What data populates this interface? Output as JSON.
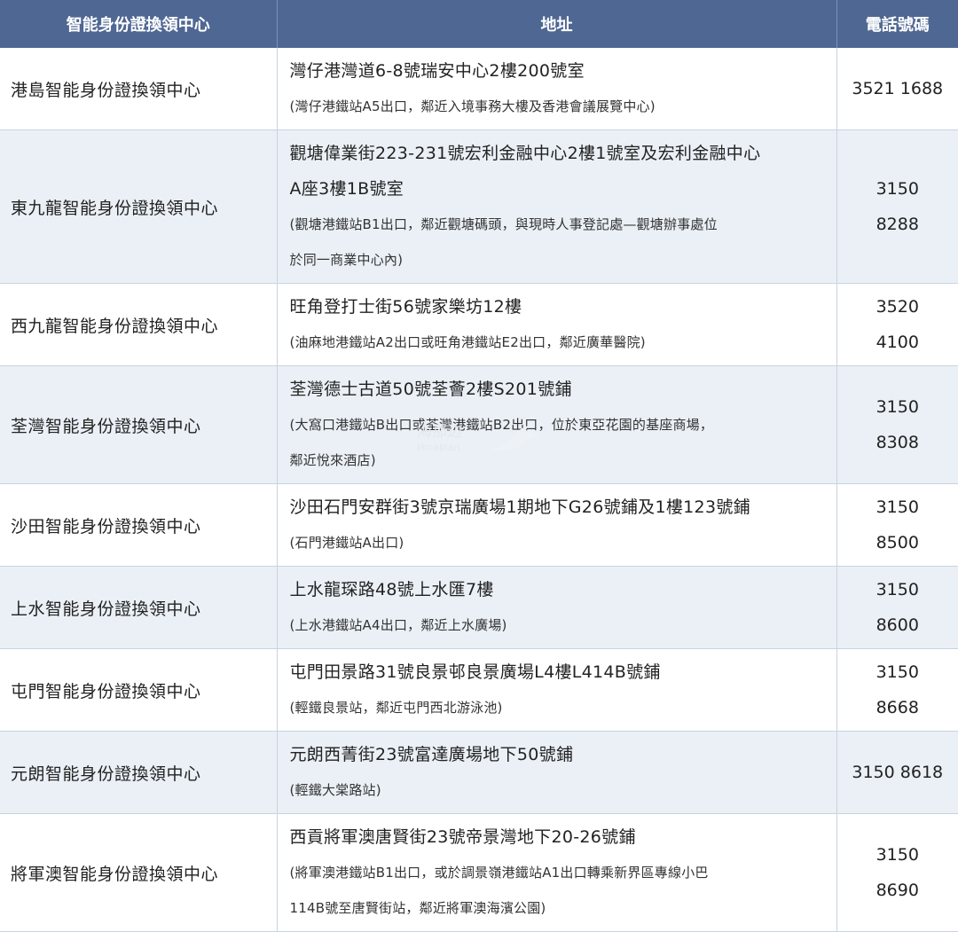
{
  "header": {
    "col_name": "智能身份證換領中心",
    "col_address": "地址",
    "col_phone": "電話號碼"
  },
  "rows": [
    {
      "name": "港島智能身份證換領中心",
      "address_lines": [
        "灣仔港灣道6-8號瑞安中心2樓200號室"
      ],
      "note_lines": [
        "(灣仔港鐵站A5出口，鄰近入境事務大樓及香港會議展覽中心)"
      ],
      "phone_lines": [
        "3521 1688"
      ]
    },
    {
      "name": "東九龍智能身份證換領中心",
      "address_lines": [
        "觀塘偉業街223-231號宏利金融中心2樓1號室及宏利金融中心",
        "A座3樓1B號室"
      ],
      "note_lines": [
        "(觀塘港鐵站B1出口，鄰近觀塘碼頭，與現時人事登記處—觀塘辦事處位",
        "於同一商業中心內)"
      ],
      "phone_lines": [
        "3150",
        "8288"
      ]
    },
    {
      "name": "西九龍智能身份證換領中心",
      "address_lines": [
        "旺角登打士街56號家樂坊12樓"
      ],
      "note_lines": [
        "(油麻地港鐵站A2出口或旺角港鐵站E2出口，鄰近廣華醫院)"
      ],
      "phone_lines": [
        "3520",
        "4100"
      ]
    },
    {
      "name": "荃灣智能身份證換領中心",
      "address_lines": [
        "荃灣德士古道50號荃薈2樓S201號鋪"
      ],
      "note_lines": [
        "(大窩口港鐵站B出口或荃灣港鐵站B2出口，位於東亞花園的基座商場，",
        "鄰近悅來酒店)"
      ],
      "phone_lines": [
        "3150",
        "8308"
      ]
    },
    {
      "name": "沙田智能身份證換領中心",
      "address_lines": [
        "沙田石門安群街3號京瑞廣場1期地下G26號鋪及1樓123號鋪"
      ],
      "note_lines": [
        "(石門港鐵站A出口)"
      ],
      "phone_lines": [
        "3150",
        "8500"
      ]
    },
    {
      "name": "上水智能身份證換領中心",
      "address_lines": [
        "上水龍琛路48號上水匯7樓"
      ],
      "note_lines": [
        "(上水港鐵站A4出口，鄰近上水廣場)"
      ],
      "phone_lines": [
        "3150",
        "8600"
      ]
    },
    {
      "name": "屯門智能身份證換領中心",
      "address_lines": [
        "屯門田景路31號良景邨良景廣場L4樓L414B號鋪"
      ],
      "note_lines": [
        "(輕鐵良景站，鄰近屯門西北游泳池)"
      ],
      "phone_lines": [
        "3150",
        "8668"
      ]
    },
    {
      "name": "元朗智能身份證換領中心",
      "address_lines": [
        "元朗西菁街23號富達廣場地下50號鋪"
      ],
      "note_lines": [
        "(輕鐵大棠路站)"
      ],
      "phone_lines": [
        "3150 8618"
      ]
    },
    {
      "name": "將軍澳智能身份證換領中心",
      "address_lines": [
        "西貢將軍澳唐賢街23號帝景灣地下20-26號鋪"
      ],
      "note_lines": [
        "(將軍澳港鐵站B1出口，或於調景嶺港鐵站A1出口轉乘新界區專線小巴",
        "114B號至唐賢街站，鄰近將軍澳海濱公園)"
      ],
      "phone_lines": [
        "3150",
        "8690"
      ]
    }
  ],
  "watermark": {
    "text": "海那边",
    "sub": "Hinabian"
  },
  "colors": {
    "header_bg": "#4f6793",
    "stripe_bg": "#eaf0f6",
    "border": "#c9d3df"
  }
}
